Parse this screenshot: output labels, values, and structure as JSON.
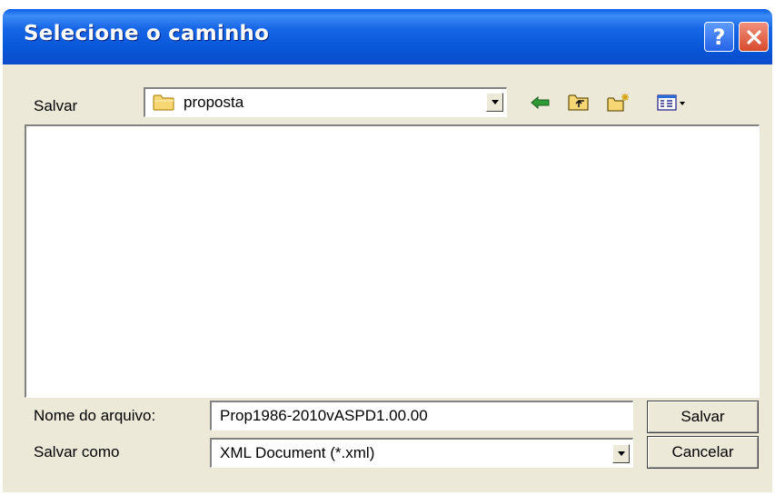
{
  "window": {
    "title": "Selecione o caminho",
    "help_glyph": "?",
    "titlebar_color": "#0A5FE8",
    "close_color": "#D74A2C",
    "face_color": "#ECE9D8"
  },
  "location": {
    "label": "Salvar",
    "folder_name": "proposta",
    "folder_icon": "folder-icon"
  },
  "toolbar": {
    "back_icon": "back-arrow-icon",
    "up_icon": "up-folder-icon",
    "new_folder_icon": "new-folder-icon",
    "view_icon": "view-menu-icon"
  },
  "file_list": {
    "items": []
  },
  "filename": {
    "label": "Nome do arquivo:",
    "value": "Prop1986-2010vASPD1.00.00"
  },
  "filetype": {
    "label": "Salvar como",
    "value": "XML Document (*.xml)"
  },
  "buttons": {
    "save_label": "Salvar",
    "cancel_label": "Cancelar"
  }
}
